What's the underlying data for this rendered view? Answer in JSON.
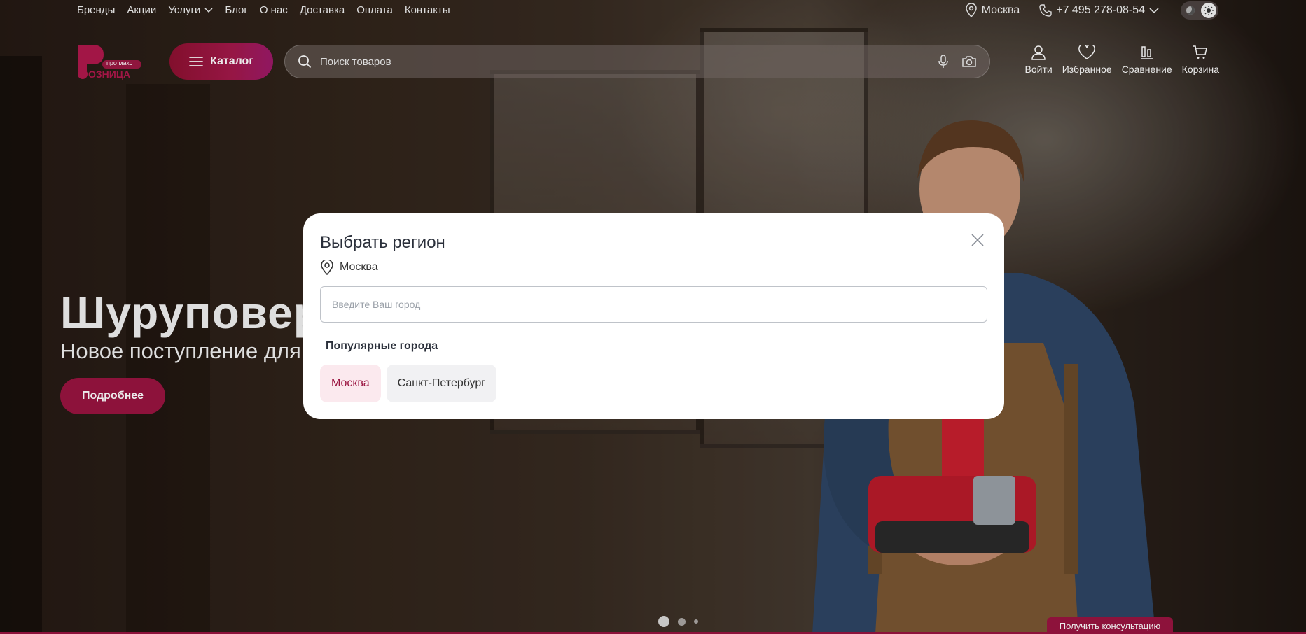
{
  "topnav": {
    "links": [
      "Бренды",
      "Акции",
      "Услуги",
      "Блог",
      "О нас",
      "Доставка",
      "Оплата",
      "Контакты"
    ],
    "city": "Москва",
    "phone": "+7 495 278-08-54"
  },
  "header": {
    "logo_tag": "про макс",
    "logo_text": "ОЗНИЦА",
    "catalog_label": "Каталог",
    "search_placeholder": "Поиск товаров",
    "actions": [
      {
        "label": "Войти",
        "icon": "user-icon"
      },
      {
        "label": "Избранное",
        "icon": "heart-icon"
      },
      {
        "label": "Сравнение",
        "icon": "compare-icon"
      },
      {
        "label": "Корзина",
        "icon": "cart-icon"
      }
    ]
  },
  "hero": {
    "title": "Шуруповерт",
    "subtitle": "Новое поступление для",
    "button_label": "Подробнее",
    "slides_total": 3,
    "active_slide": 1
  },
  "consult_label": "Получить консультацию",
  "region_modal": {
    "title": "Выбрать регион",
    "current_city": "Москва",
    "input_placeholder": "Введите Ваш город",
    "popular_label": "Популярные города",
    "popular_cities": [
      "Москва",
      "Санкт-Петербург"
    ],
    "selected_city": "Москва"
  },
  "colors": {
    "brand": "#9a1440",
    "chip_active_bg": "#fbe9ee"
  }
}
